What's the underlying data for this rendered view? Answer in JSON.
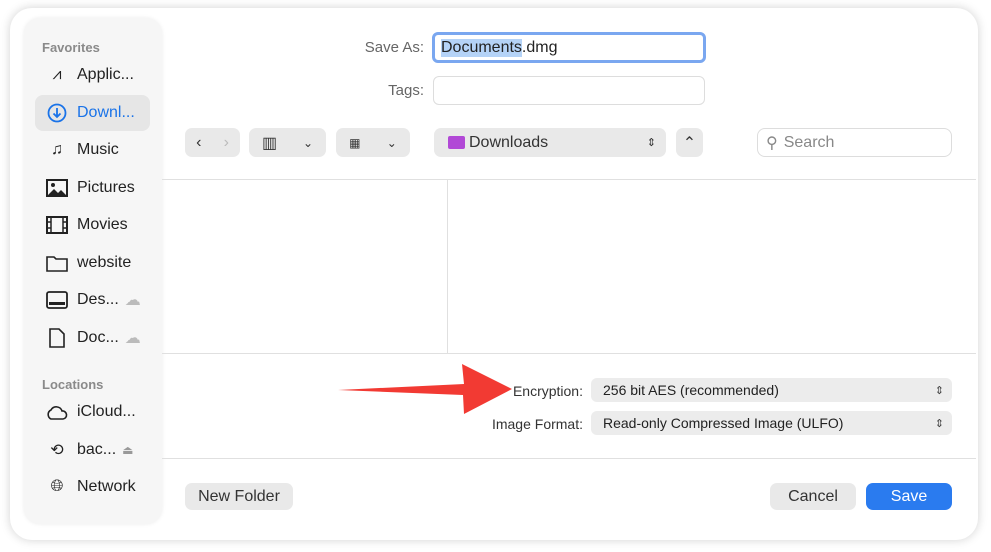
{
  "sidebar": {
    "favorites_title": "Favorites",
    "locations_title": "Locations",
    "favorites": [
      {
        "label": "Applic..."
      },
      {
        "label": "Downl..."
      },
      {
        "label": "Music"
      },
      {
        "label": "Pictures"
      },
      {
        "label": "Movies"
      },
      {
        "label": "website"
      },
      {
        "label": "Des..."
      },
      {
        "label": "Doc..."
      }
    ],
    "locations": [
      {
        "label": "iCloud..."
      },
      {
        "label": "bac..."
      },
      {
        "label": "Network"
      }
    ]
  },
  "save_as": {
    "label": "Save As:",
    "value_selected": "Documents",
    "value_rest": ".dmg"
  },
  "tags": {
    "label": "Tags:",
    "value": ""
  },
  "toolbar": {
    "location": "Downloads",
    "search_placeholder": "Search"
  },
  "options": {
    "encryption_label": "Encryption:",
    "encryption_value": "256 bit AES (recommended)",
    "format_label": "Image Format:",
    "format_value": "Read-only Compressed Image (ULFO)"
  },
  "buttons": {
    "new_folder": "New Folder",
    "cancel": "Cancel",
    "save": "Save"
  },
  "colors": {
    "accent": "#2a7bef",
    "arrow": "#f23a33"
  }
}
